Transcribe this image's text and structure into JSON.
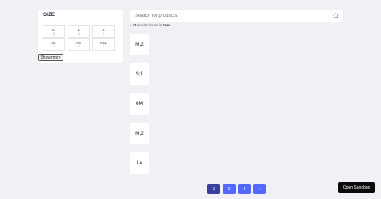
{
  "filter": {
    "title": "SIZE",
    "sizes": [
      {
        "label": "M",
        "count": "2"
      },
      {
        "label": "L",
        "count": "1"
      },
      {
        "label": "S",
        "count": "1"
      },
      {
        "label": "XL",
        "count": "1"
      },
      {
        "label": "XS",
        "count": "1"
      },
      {
        "label": "XXL",
        "count": "1"
      }
    ],
    "show_more": "Show more"
  },
  "search": {
    "placeholder": "Search for products"
  },
  "stats": {
    "prefix": "›",
    "count": "11",
    "middle": "results found in",
    "time": "1ms"
  },
  "hits": [
    "M;2",
    "S;1",
    "9M",
    "M;2",
    "1A"
  ],
  "pagination": {
    "pages": [
      "1",
      "2",
      "3",
      "›"
    ],
    "active": "1"
  },
  "sandbox": {
    "label": "Open Sandbox"
  }
}
